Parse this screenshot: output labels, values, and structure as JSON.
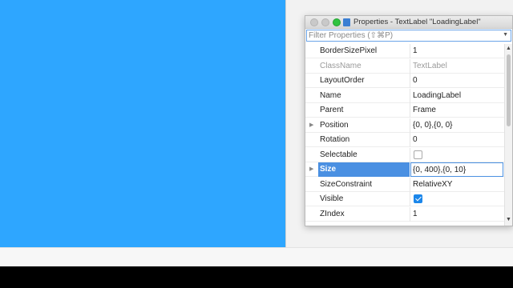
{
  "window": {
    "title": "Properties - TextLabel \"LoadingLabel\""
  },
  "filter": {
    "placeholder": "Filter Properties (⇧⌘P)"
  },
  "properties": [
    {
      "name": "BorderSizePixel",
      "value": "1"
    },
    {
      "name": "ClassName",
      "value": "TextLabel"
    },
    {
      "name": "LayoutOrder",
      "value": "0"
    },
    {
      "name": "Name",
      "value": "LoadingLabel"
    },
    {
      "name": "Parent",
      "value": "Frame"
    },
    {
      "name": "Position",
      "value": "{0, 0},{0, 0}"
    },
    {
      "name": "Rotation",
      "value": "0"
    },
    {
      "name": "Selectable",
      "checked": false
    },
    {
      "name": "Size",
      "value": "{0, 400},{0, 10}"
    },
    {
      "name": "SizeConstraint",
      "value": "RelativeXY"
    },
    {
      "name": "Visible",
      "checked": true
    },
    {
      "name": "ZIndex",
      "value": "1"
    }
  ],
  "colors": {
    "viewport": "#2ea6ff",
    "selection": "#4a90e2",
    "checkbox_on": "#1b86ea"
  }
}
